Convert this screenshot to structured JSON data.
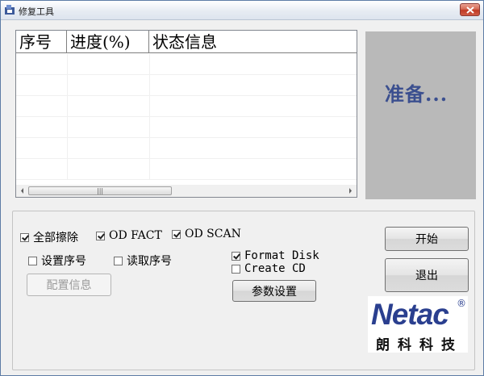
{
  "window": {
    "title": "修复工具",
    "close_icon": "close-icon"
  },
  "listview": {
    "columns": [
      "序号",
      "进度(%)",
      "状态信息"
    ],
    "scroll_grip": "|||"
  },
  "status": {
    "text": "准备..."
  },
  "options": {
    "erase_all": {
      "label": "全部擦除",
      "checked": true
    },
    "od_fact": {
      "label": "OD FACT",
      "checked": true
    },
    "od_scan": {
      "label": "OD SCAN",
      "checked": true
    },
    "set_serial": {
      "label": "设置序号",
      "checked": false
    },
    "read_serial": {
      "label": "读取序号",
      "checked": false
    },
    "format_disk": {
      "label": "Format Disk",
      "checked": true
    },
    "create_cd": {
      "label": "Create CD",
      "checked": false
    }
  },
  "buttons": {
    "config_info": "配置信息",
    "param_settings": "参数设置",
    "start": "开始",
    "exit": "退出"
  },
  "logo": {
    "word": "Netac",
    "reg": "®",
    "cn": "朗科科技",
    "brand_color": "#2a3f8f"
  }
}
